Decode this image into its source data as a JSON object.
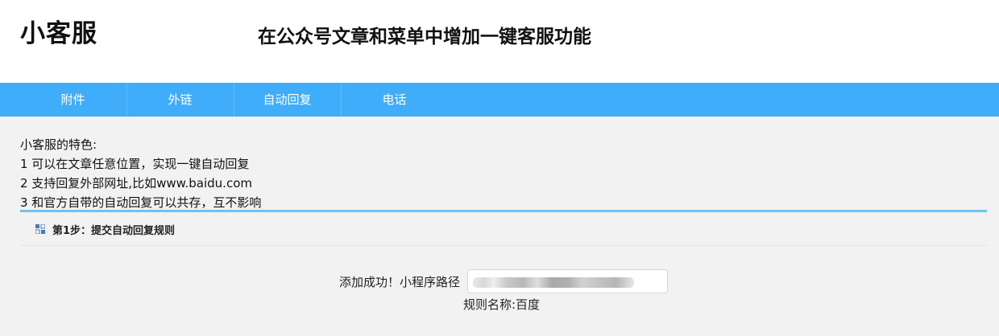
{
  "header": {
    "logo": "小客服",
    "slogan": "在公众号文章和菜单中增加一键客服功能"
  },
  "nav": {
    "items": [
      {
        "label": "附件"
      },
      {
        "label": "外链"
      },
      {
        "label": "自动回复"
      },
      {
        "label": "电话"
      }
    ]
  },
  "features": {
    "title": "小客服的特色:",
    "lines": [
      "1 可以在文章任意位置，实现一键自动回复",
      "2 支持回复外部网址,比如www.baidu.com",
      "3 和官方自带的自动回复可以共存，互不影响"
    ]
  },
  "step": {
    "label": "第1步：提交自动回复规则",
    "icon": "grid-icon"
  },
  "result": {
    "message": "添加成功！小程序路径",
    "rule_name": "规则名称:百度"
  },
  "colors": {
    "nav_bg": "#3fadf9",
    "divider": "#72c1f0"
  }
}
